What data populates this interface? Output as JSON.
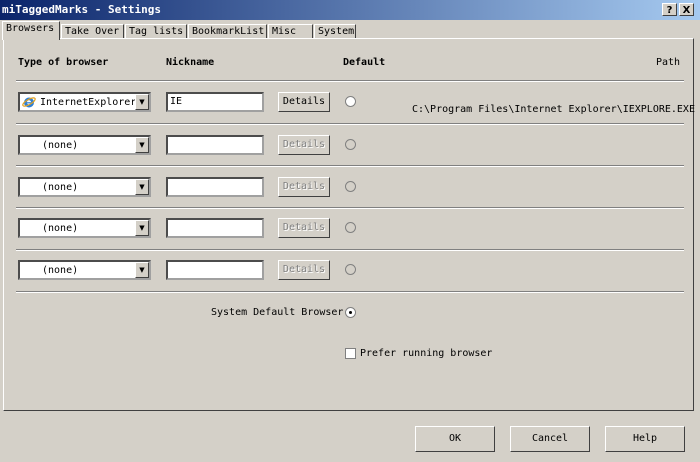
{
  "window": {
    "title": "miTaggedMarks - Settings",
    "help_btn": "?",
    "close_btn": "X"
  },
  "tabs": [
    {
      "label": "Browsers"
    },
    {
      "label": "Take Over"
    },
    {
      "label": "Tag lists"
    },
    {
      "label": "BookmarkList"
    },
    {
      "label": "Misc"
    },
    {
      "label": "System"
    }
  ],
  "headers": {
    "type": "Type of browser",
    "nickname": "Nickname",
    "default": "Default",
    "path": "Path"
  },
  "rows": [
    {
      "browser": "InternetExplorer",
      "nickname": "IE",
      "details": "Details",
      "path": "C:\\Program Files\\Internet Explorer\\IEXPLORE.EXE"
    },
    {
      "browser": "(none)",
      "nickname": "",
      "details": "Details"
    },
    {
      "browser": "(none)",
      "nickname": "",
      "details": "Details"
    },
    {
      "browser": "(none)",
      "nickname": "",
      "details": "Details"
    },
    {
      "browser": "(none)",
      "nickname": "",
      "details": "Details"
    }
  ],
  "system_default_label": "System Default Browser",
  "prefer_running_label": "Prefer running browser",
  "buttons": {
    "ok": "OK",
    "cancel": "Cancel",
    "help": "Help"
  }
}
